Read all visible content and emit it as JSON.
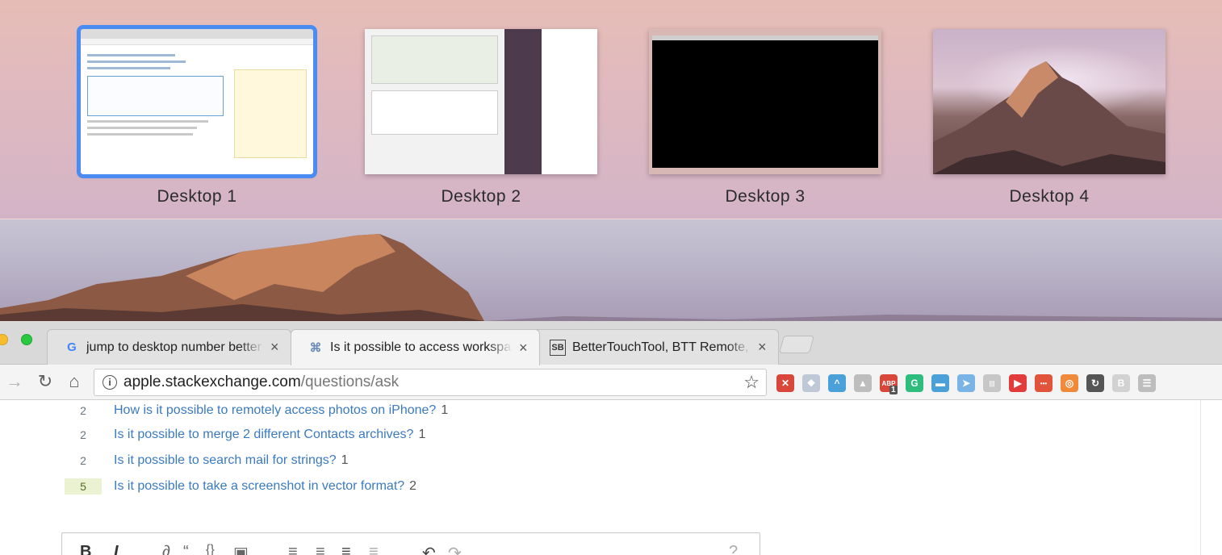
{
  "mission_control": {
    "spaces": [
      {
        "label": "Desktop 1",
        "active": true
      },
      {
        "label": "Desktop 2",
        "active": false
      },
      {
        "label": "Desktop 3",
        "active": false
      },
      {
        "label": "Desktop 4",
        "active": false
      }
    ]
  },
  "browser": {
    "tabs": [
      {
        "favicon": "G",
        "title": "jump to desktop number better",
        "close": "×"
      },
      {
        "favicon": "⌘",
        "title": "Is it possible to access workspaces",
        "close": "×"
      },
      {
        "favicon": "SB",
        "title": "BetterTouchTool, BTT Remote, ",
        "close": "×"
      }
    ],
    "url": {
      "host": "apple.stackexchange.com",
      "path": "/questions/ask"
    },
    "extension_icons": [
      {
        "name": "x-ext-icon",
        "color": "#d9463a",
        "glyph": "✕"
      },
      {
        "name": "dropbox-ext-icon",
        "color": "#bfc8d6",
        "glyph": "❖"
      },
      {
        "name": "wave-ext-icon",
        "color": "#4aa0d8",
        "glyph": "^"
      },
      {
        "name": "drive-ext-icon",
        "color": "#bdbdbd",
        "glyph": "▲"
      },
      {
        "name": "adblock-ext-icon",
        "color": "#d9463a",
        "glyph": "ABP"
      },
      {
        "name": "grammarly-ext-icon",
        "color": "#2ebd7d",
        "glyph": "G"
      },
      {
        "name": "pushbullet-ext-icon",
        "color": "#4ba0d8",
        "glyph": "▬"
      },
      {
        "name": "compass-ext-icon",
        "color": "#7ab4e6",
        "glyph": "➤"
      },
      {
        "name": "barcode-ext-icon",
        "color": "#c7c7c7",
        "glyph": "|||"
      },
      {
        "name": "video-ext-icon",
        "color": "#e23b3b",
        "glyph": "▶"
      },
      {
        "name": "dots-ext-icon",
        "color": "#e2533b",
        "glyph": "•••"
      },
      {
        "name": "lifebuoy-ext-icon",
        "color": "#f08a3a",
        "glyph": "◎"
      },
      {
        "name": "refresh-ext-icon",
        "color": "#555555",
        "glyph": "↻"
      },
      {
        "name": "b-ext-icon",
        "color": "#d2d2d2",
        "glyph": "B"
      },
      {
        "name": "menu-ext-icon",
        "color": "#bdbdbd",
        "glyph": "☰"
      }
    ],
    "adblock_badge": "1"
  },
  "related_questions": [
    {
      "score": "2",
      "title": "How is it possible to remotely access photos on iPhone?",
      "count": "1",
      "highlight": false
    },
    {
      "score": "2",
      "title": "Is it possible to merge 2 different Contacts archives?",
      "count": "1",
      "highlight": false
    },
    {
      "score": "2",
      "title": "Is it possible to search mail for strings?",
      "count": "1",
      "highlight": false
    },
    {
      "score": "5",
      "title": "Is it possible to take a screenshot in vector format?",
      "count": "2",
      "highlight": true
    }
  ],
  "editor_toolbar": [
    "B",
    "I"
  ],
  "colors": {
    "active_space_outline": "#4a8cf2",
    "link": "#3b7abf",
    "score_highlight_bg": "#eaf2d2"
  }
}
